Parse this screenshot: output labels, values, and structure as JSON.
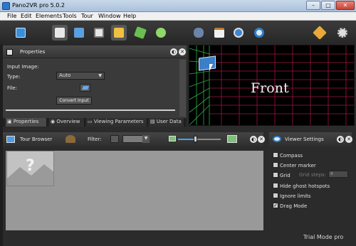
{
  "window": {
    "title": "Pano2VR pro 5.0.2",
    "minimize": "–",
    "maximize": "□",
    "close": "✕"
  },
  "menu": [
    "File",
    "Edit",
    "Elements",
    "Tools",
    "Tour",
    "Window",
    "Help"
  ],
  "toolbar_icons": [
    "input-image-icon",
    "tiles-icon",
    "viewer-icon",
    "patches-icon",
    "tour-map-icon",
    "map-icon",
    "user-data-icon",
    "binoculars-icon",
    "clipboard-icon",
    "gear-panorama-icon",
    "eye-icon",
    "star-icon",
    "reel-icon"
  ],
  "properties": {
    "title": "Properties",
    "section": "Input Image:",
    "type_label": "Type:",
    "type_value": "Auto",
    "file_label": "File:",
    "convert_label": "Convert Input"
  },
  "tabs": [
    "Properties",
    "Overview",
    "Viewing Parameters",
    "User Data"
  ],
  "viewer": {
    "label": "Front"
  },
  "tour_browser": {
    "title": "Tour Browser",
    "filter_label": "Filter:"
  },
  "viewer_settings": {
    "title": "Viewer Settings",
    "options": [
      {
        "label": "Compass",
        "checked": false
      },
      {
        "label": "Center marker",
        "checked": false
      },
      {
        "label": "Grid",
        "checked": false
      },
      {
        "label": "Hide ghost hotspots",
        "checked": false
      },
      {
        "label": "Ignore limits",
        "checked": false
      },
      {
        "label": "Drag Mode",
        "checked": true
      }
    ],
    "grid_steps_label": "Grid steps:",
    "grid_steps_value": "8"
  },
  "status": {
    "trial": "Trial Mode pro"
  },
  "colors": {
    "grid_red": "#a0153f",
    "grid_green": "#2fb04a",
    "accent": "#42a5f5"
  }
}
